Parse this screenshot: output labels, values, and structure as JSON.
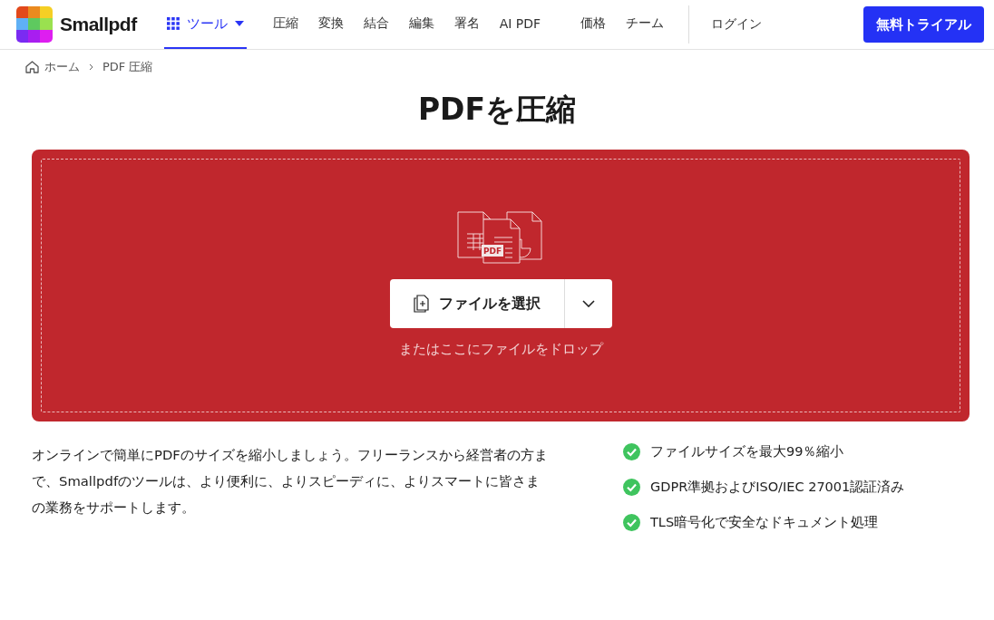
{
  "header": {
    "brand": "Smallpdf",
    "nav": [
      {
        "label": "ツール",
        "kind": "menu",
        "selected": true
      },
      {
        "label": "圧縮",
        "kind": "link",
        "selected": false
      },
      {
        "label": "変換",
        "kind": "link",
        "selected": false
      },
      {
        "label": "結合",
        "kind": "link",
        "selected": false
      },
      {
        "label": "編集",
        "kind": "link",
        "selected": false
      },
      {
        "label": "署名",
        "kind": "link",
        "selected": false
      },
      {
        "label": "AI PDF",
        "kind": "link",
        "selected": false
      }
    ],
    "secondary_nav": [
      "価格",
      "チーム"
    ],
    "login": "ログイン",
    "trial_button": "無料トライアル"
  },
  "breadcrumb": [
    "ホーム",
    "PDF 圧縮"
  ],
  "title": "PDFを圧縮",
  "dropzone": {
    "file_badge": "PDF",
    "choose_button": "ファイルを選択",
    "hint": "またはここにファイルをドロップ"
  },
  "description": "オンラインで簡単にPDFのサイズを縮小しましょう。フリーランスから経営者の方まで、Smallpdfのツールは、より便利に、よりスピーディに、よりスマートに皆さまの業務をサポートします。",
  "features": [
    "ファイルサイズを最大99％縮小",
    "GDPR準拠およびISO/IEC 27001認証済み",
    "TLS暗号化で安全なドキュメント処理"
  ]
}
